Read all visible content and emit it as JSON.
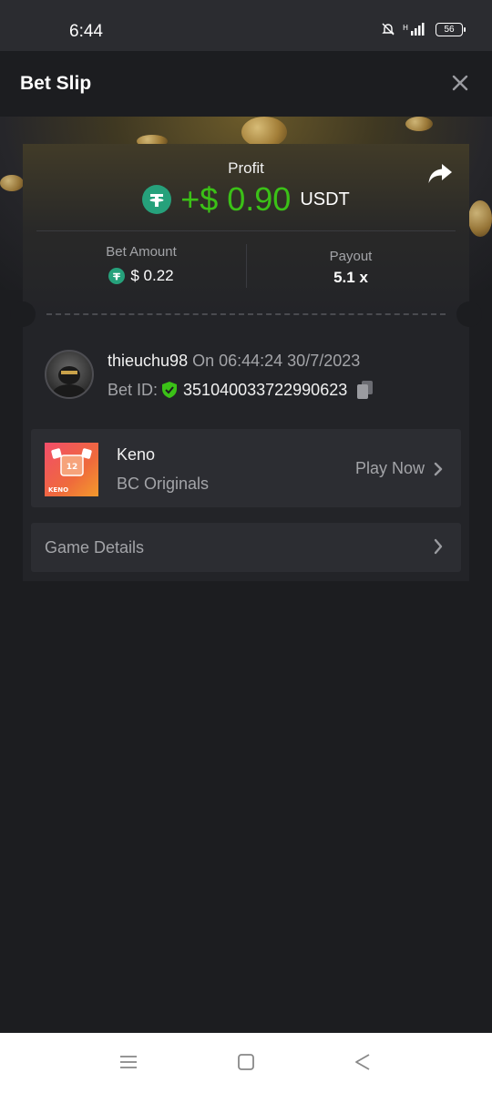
{
  "status_bar": {
    "time": "6:44",
    "battery": "56"
  },
  "header": {
    "title": "Bet Slip"
  },
  "profit": {
    "label": "Profit",
    "amount": "+$ 0.90",
    "currency": "USDT"
  },
  "bet_amount": {
    "label": "Bet Amount",
    "value": "$ 0.22"
  },
  "payout": {
    "label": "Payout",
    "value": "5.1 x"
  },
  "user": {
    "name": "thieuchu98",
    "on_text": "On 06:44:24 30/7/2023",
    "bet_id_label": "Bet ID:",
    "bet_id": "351040033722990623"
  },
  "game": {
    "name": "Keno",
    "provider": "BC Originals",
    "play_label": "Play Now",
    "thumb_number": "12",
    "thumb_text": "KENO"
  },
  "details": {
    "label": "Game Details"
  },
  "colors": {
    "profit_green": "#3bc117",
    "tether_green": "#26a17b",
    "background": "#1c1d20",
    "card": "#232428"
  },
  "icons": [
    "close-icon",
    "share-icon",
    "tether-icon",
    "shield-check-icon",
    "copy-icon",
    "chevron-right-icon",
    "menu-icon",
    "home-square-icon",
    "back-triangle-icon"
  ]
}
